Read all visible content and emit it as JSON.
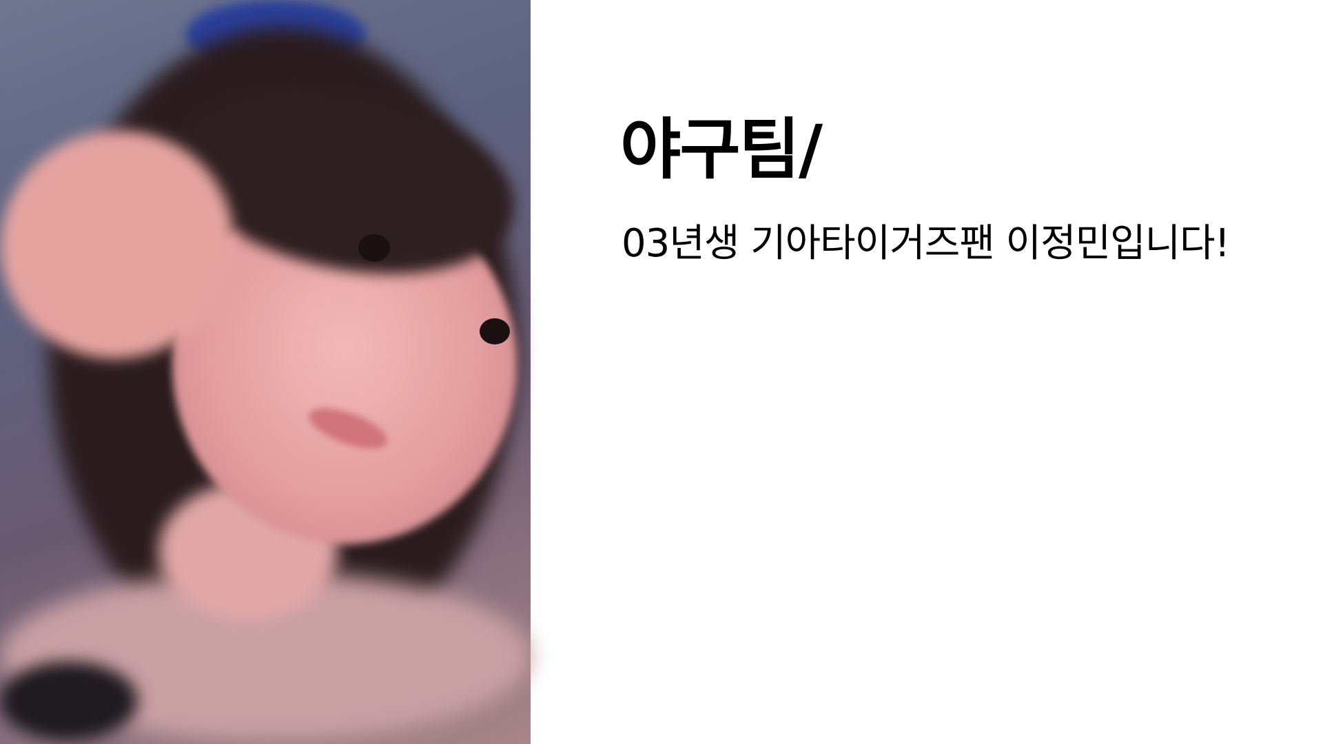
{
  "slide": {
    "title": "야구팀/",
    "subtitle": "03년생 기아타이거즈팬 이정민입니다!",
    "photo": "portrait-photo"
  },
  "colors": {
    "background": "#ffffff",
    "text": "#000000"
  }
}
